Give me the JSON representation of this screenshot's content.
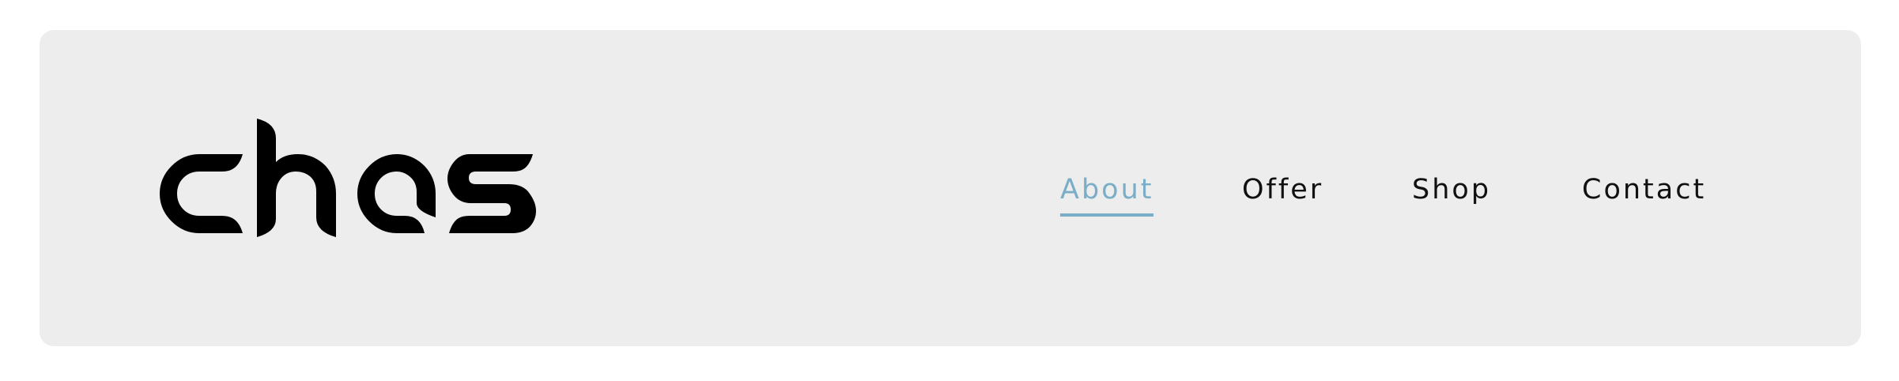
{
  "header": {
    "logo": {
      "text": "chas",
      "icon": "chas-wordmark-logo"
    },
    "nav": {
      "items": [
        {
          "label": "About",
          "active": true
        },
        {
          "label": "Offer",
          "active": false
        },
        {
          "label": "Shop",
          "active": false
        },
        {
          "label": "Contact",
          "active": false
        }
      ]
    }
  },
  "colors": {
    "background": "#ffffff",
    "header_background": "#ededed",
    "text": "#111111",
    "active_accent": "#7aaec8"
  }
}
